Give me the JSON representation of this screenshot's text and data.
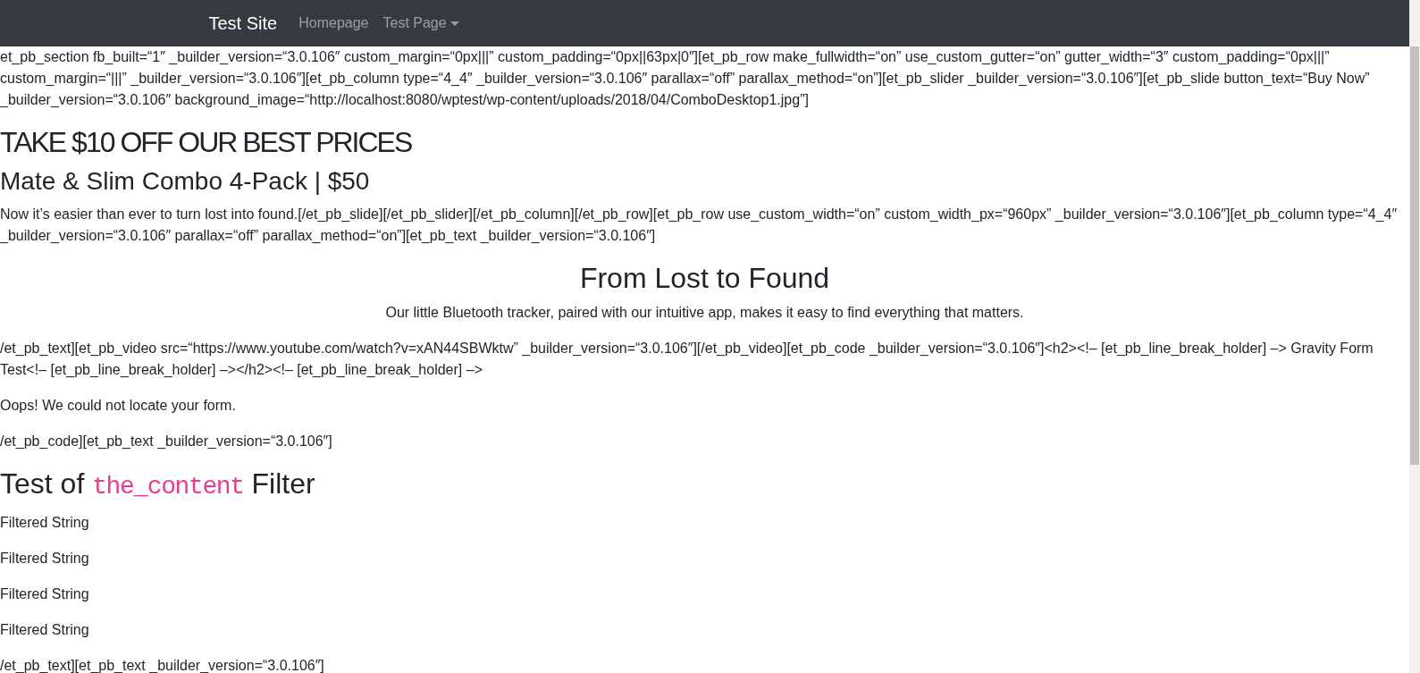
{
  "navbar": {
    "brand": "Test Site",
    "links": [
      {
        "label": "Homepage",
        "kind": "link",
        "selected": false
      },
      {
        "label": "Test Page",
        "kind": "dropdown",
        "selected": false
      }
    ]
  },
  "content": [
    {
      "kind": "paragraph",
      "text": "et_pb_section fb_built=“1″ _builder_version=“3.0.106″ custom_margin=“0px|||” custom_padding=“0px||63px|0″][et_pb_row make_fullwidth=“on” use_custom_gutter=“on” gutter_width=“3″ custom_padding=“0px|||” custom_margin=“|||” _builder_version=“3.0.106″][et_pb_column type=“4_4″ _builder_version=“3.0.106″ parallax=“off” parallax_method=“on”][et_pb_slider _builder_version=“3.0.106″][et_pb_slide button_text=“Buy Now” _builder_version=“3.0.106″ background_image=“http://localhost:8080/wptest/wp-content/uploads/2018/04/ComboDesktop1.jpg”]"
    },
    {
      "kind": "banner_heading",
      "text": "TAKE $10 OFF OUR BEST PRICES"
    },
    {
      "kind": "subheading",
      "text": "Mate & Slim Combo 4-Pack | $50"
    },
    {
      "kind": "paragraph",
      "text": "Now it’s easier than ever to turn lost into found.[/et_pb_slide][/et_pb_slider][/et_pb_column][/et_pb_row][et_pb_row use_custom_width=“on” custom_width_px=“960px” _builder_version=“3.0.106″][et_pb_column type=“4_4″ _builder_version=“3.0.106″ parallax=“off” parallax_method=“on”][et_pb_text _builder_version=“3.0.106″]"
    },
    {
      "kind": "centered_heading",
      "text": "From Lost to Found"
    },
    {
      "kind": "centered_paragraph",
      "text": "Our little Bluetooth tracker, paired with our intuitive app, makes it easy to find everything that matters."
    },
    {
      "kind": "paragraph",
      "text": "/et_pb_text][et_pb_video src=“https://www.youtube.com/watch?v=xAN44SBWktw” _builder_version=“3.0.106″][/et_pb_video][et_pb_code _builder_version=“3.0.106″]<h2><!– [et_pb_line_break_holder] –> Gravity Form Test<!– [et_pb_line_break_holder] –></h2><!– [et_pb_line_break_holder] –>"
    },
    {
      "kind": "paragraph",
      "text": "Oops! We could not locate your form."
    },
    {
      "kind": "paragraph",
      "text": "/et_pb_code][et_pb_text _builder_version=“3.0.106″]"
    },
    {
      "kind": "code_heading",
      "parts": [
        {
          "kind": "text",
          "text": "Test of "
        },
        {
          "kind": "code",
          "text": "the_content"
        },
        {
          "kind": "text",
          "text": " Filter"
        }
      ]
    },
    {
      "kind": "paragraph",
      "text": "Filtered String"
    },
    {
      "kind": "paragraph",
      "text": "Filtered String"
    },
    {
      "kind": "paragraph",
      "text": "Filtered String"
    },
    {
      "kind": "paragraph",
      "text": "Filtered String"
    },
    {
      "kind": "paragraph",
      "text": "/et_pb_text][et_pb_text _builder_version=“3.0.106″]"
    }
  ]
}
